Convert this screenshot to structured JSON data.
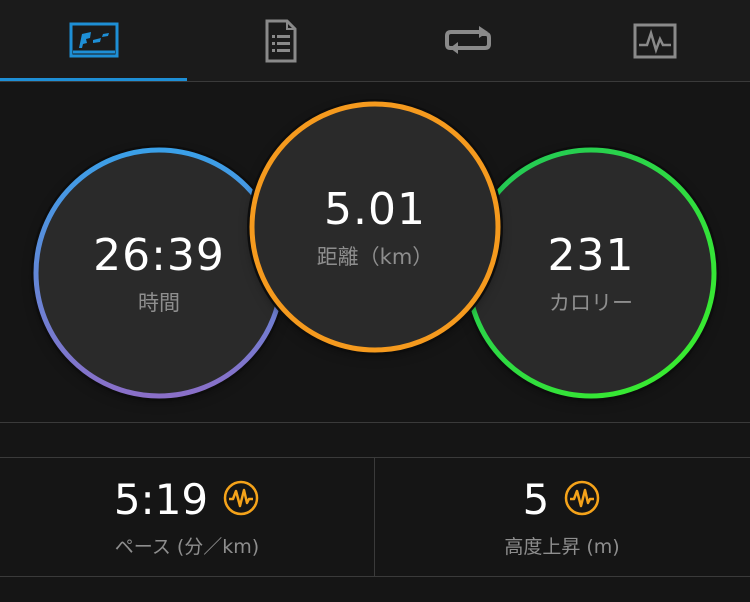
{
  "tabs": [
    {
      "id": "summary",
      "icon": "run-chart-icon",
      "active": true
    },
    {
      "id": "details",
      "icon": "document-list-icon",
      "active": false
    },
    {
      "id": "laps",
      "icon": "loop-icon",
      "active": false
    },
    {
      "id": "charts",
      "icon": "activity-graph-icon",
      "active": false
    }
  ],
  "metrics": {
    "time": {
      "value": "26:39",
      "label": "時間",
      "ring_colors": [
        "#3aa0e8",
        "#8a6fc8"
      ]
    },
    "distance": {
      "value": "5.01",
      "label": "距離（km）",
      "ring_color": "#f59a1e"
    },
    "calories": {
      "value": "231",
      "label": "カロリー",
      "ring_colors": [
        "#21c55a",
        "#3cf02a"
      ]
    }
  },
  "stats": {
    "pace": {
      "value": "5:19",
      "label": "ペース (分／km)",
      "icon": "pulse-icon"
    },
    "elevation": {
      "value": "5",
      "label": "高度上昇 (m)",
      "icon": "pulse-icon"
    }
  },
  "colors": {
    "accent": "#1e8fd6",
    "icon_orange": "#f5a31a",
    "background": "#151515"
  }
}
